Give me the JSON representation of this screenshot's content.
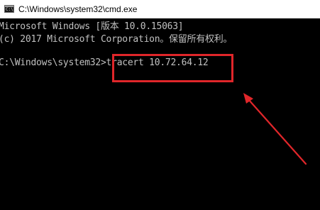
{
  "window": {
    "title": "C:\\Windows\\system32\\cmd.exe",
    "icon": "cmd-icon"
  },
  "console": {
    "lines": [
      "Microsoft Windows [版本 10.0.15063]",
      "(c) 2017 Microsoft Corporation。保留所有权利。"
    ],
    "prompt": "C:\\Windows\\system32>",
    "command": "tracert 10.72.64.12"
  },
  "annotation": {
    "highlight_color": "#e0262a",
    "arrow_color": "#e0262a"
  }
}
